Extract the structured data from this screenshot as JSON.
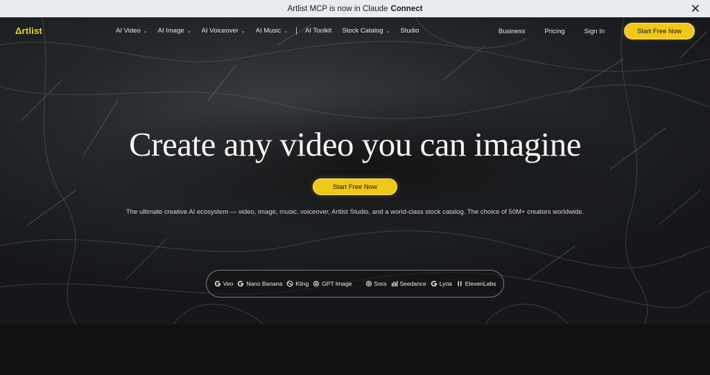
{
  "banner": {
    "text": "Artlist MCP is now in Claude",
    "bold": "Connect"
  },
  "brand": {
    "logo": "Δrtlist",
    "accent": "#f0c81a"
  },
  "nav": {
    "items": [
      {
        "label": "AI Video",
        "dropdown": true
      },
      {
        "label": "AI Image",
        "dropdown": true
      },
      {
        "label": "AI Voiceover",
        "dropdown": true
      },
      {
        "label": "AI Music",
        "dropdown": true
      }
    ],
    "items2": [
      {
        "label": "AI Toolkit",
        "dropdown": false
      },
      {
        "label": "Stock Catalog",
        "dropdown": true
      },
      {
        "label": "Studio",
        "dropdown": false
      }
    ],
    "right": {
      "business": "Business",
      "pricing": "Pricing",
      "signin": "Sign In",
      "cta": "Start Free Now"
    }
  },
  "hero": {
    "headline": "Create any video you can imagine",
    "cta": "Start Free Now",
    "subtitle": "The ultimate creative AI ecosystem — video, image, music, voiceover, Artlist Studio, and a world-class stock catalog. The choice of 50M+ creators worldwide."
  },
  "models": [
    {
      "name": "Veo",
      "icon": "google-g-icon"
    },
    {
      "name": "Nano Banana",
      "icon": "google-g-icon"
    },
    {
      "name": "Kling",
      "icon": "kling-icon"
    },
    {
      "name": "GPT Image",
      "icon": "openai-icon"
    },
    {
      "name": "Sora",
      "icon": "openai-icon"
    },
    {
      "name": "Seedance",
      "icon": "bars-icon"
    },
    {
      "name": "Lyria",
      "icon": "google-g-icon"
    },
    {
      "name": "ElevenLabs",
      "icon": "elevenlabs-icon"
    }
  ]
}
